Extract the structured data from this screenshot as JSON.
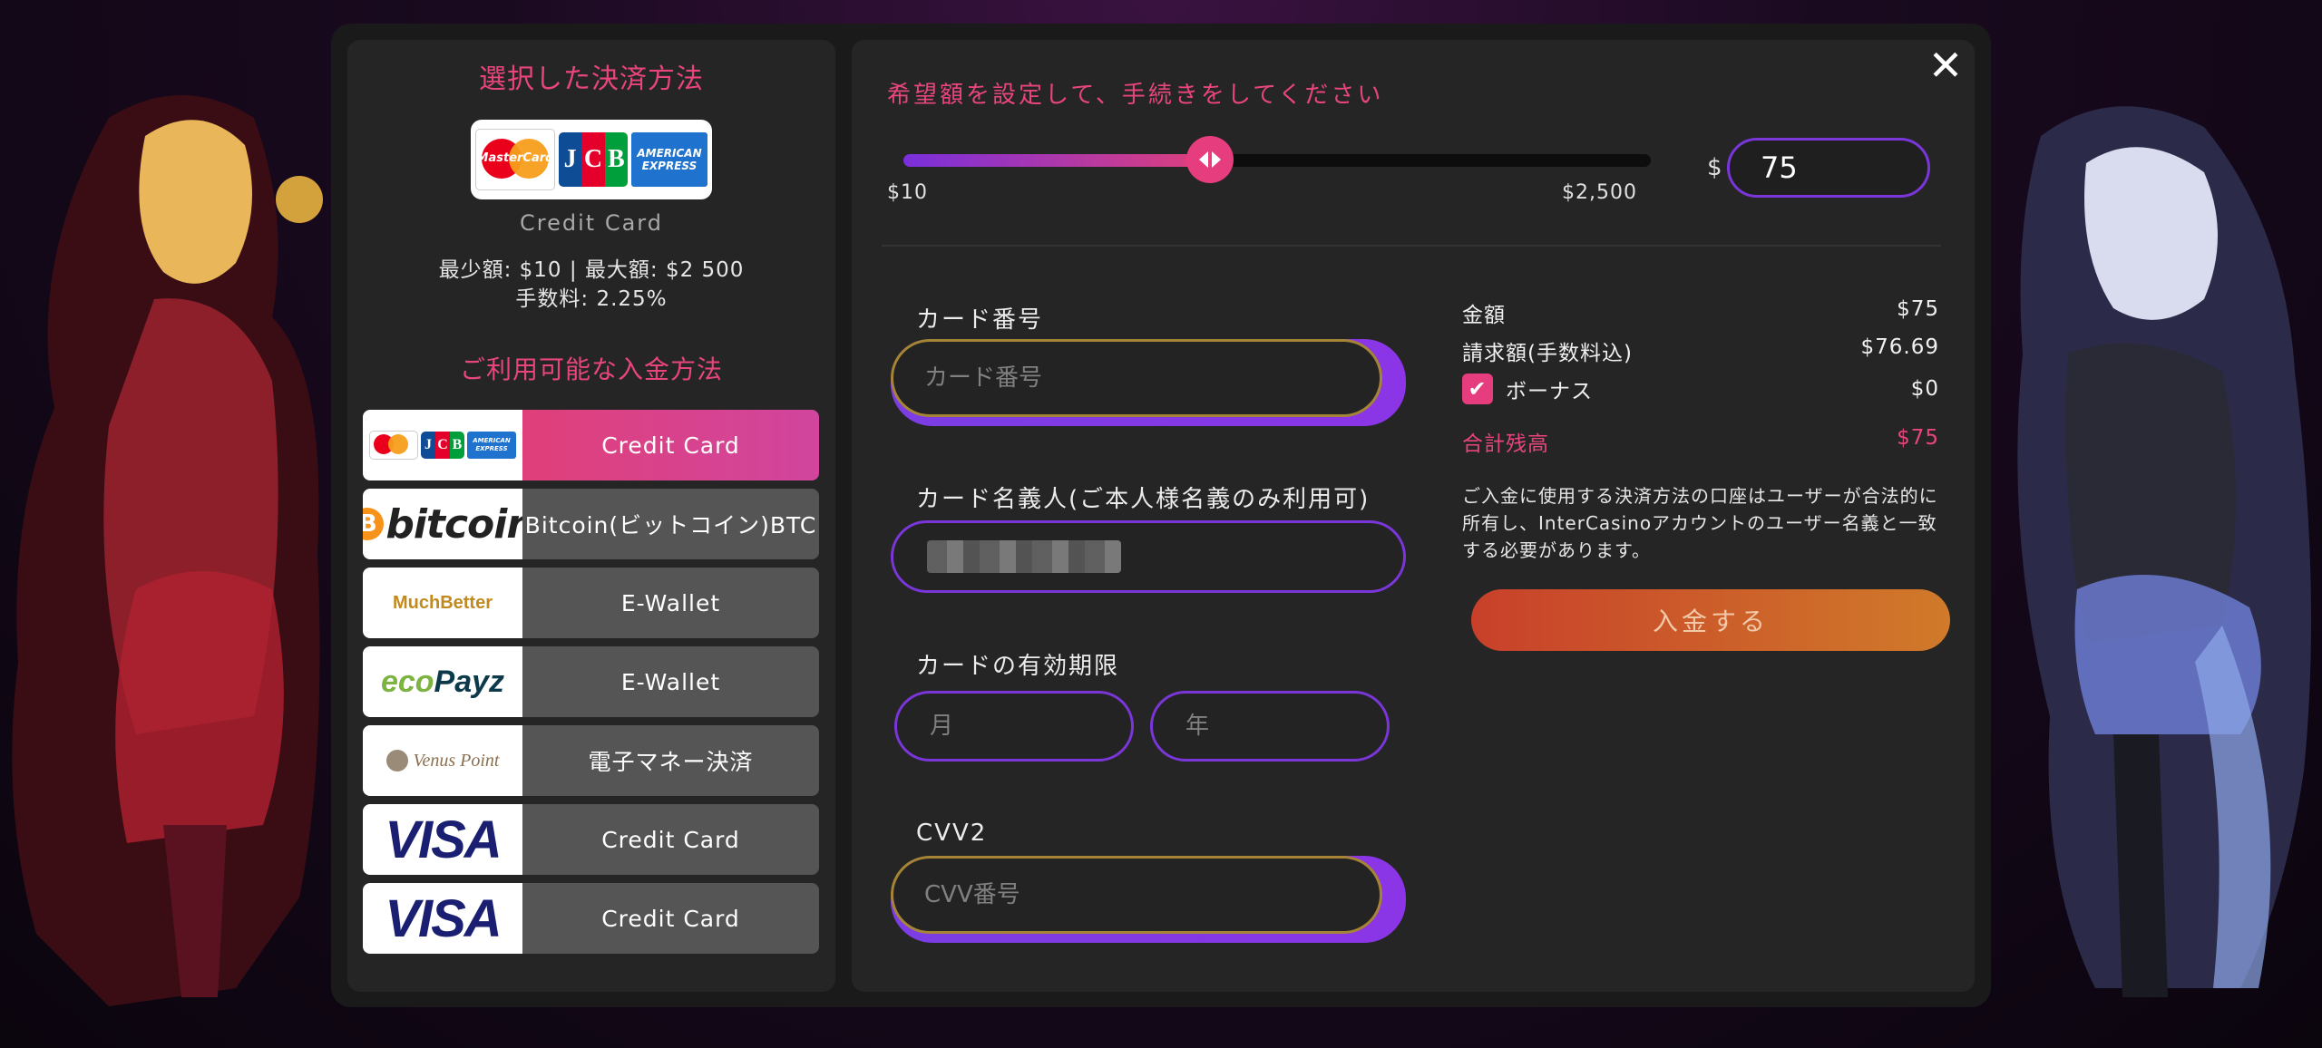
{
  "close_icon": "close-icon",
  "selected": {
    "title": "選択した決済方法",
    "logo_text": {
      "mastercard": "MasterCard",
      "jcb": [
        "J",
        "C",
        "B"
      ],
      "amex_line1": "AMERICAN",
      "amex_line2": "EXPRESS"
    },
    "label": "Credit Card",
    "limits_line": "最少額: $10 | 最大額: $2 500",
    "fee_line": "手数料: 2.25%"
  },
  "available_title": "ご利用可能な入金方法",
  "methods": [
    {
      "logo": "credit-card-brands",
      "label": "Credit Card",
      "active": true
    },
    {
      "logo": "bitcoin",
      "logo_text": "bitcoin",
      "logo_symbol": "B",
      "label": "Bitcoin(ビットコイン)BTC"
    },
    {
      "logo": "muchbetter",
      "logo_text": "MuchBetter",
      "label": "E-Wallet"
    },
    {
      "logo": "ecopayz",
      "logo_text_a": "eco",
      "logo_text_b": "Payz",
      "label": "E-Wallet"
    },
    {
      "logo": "venuspoint",
      "logo_text": "Venus Point",
      "label": "電子マネー決済"
    },
    {
      "logo": "visa",
      "logo_text": "VISA",
      "label": "Credit Card"
    },
    {
      "logo": "visa",
      "logo_text": "VISA",
      "label": "Credit Card"
    }
  ],
  "amount": {
    "title": "希望額を設定して、手続きをしてください",
    "min_label": "$10",
    "max_label": "$2,500",
    "min": 10,
    "max": 2500,
    "value": 75,
    "slider_fraction": 0.41,
    "currency": "$",
    "input_value": "75"
  },
  "form": {
    "card_number_label": "カード番号",
    "card_number_placeholder": "カード番号",
    "holder_label": "カード名義人(ご本人様名義のみ利用可)",
    "expiry_label": "カードの有効期限",
    "month_placeholder": "月",
    "year_placeholder": "年",
    "cvv_label": "CVV2",
    "cvv_placeholder": "CVV番号"
  },
  "summary": {
    "amount_label": "金額",
    "amount_value": "$75",
    "billed_label": "請求額(手数料込)",
    "billed_value": "$76.69",
    "bonus_label": "ボーナス",
    "bonus_value": "$0",
    "bonus_checked": true,
    "total_label": "合計残高",
    "total_value": "$75",
    "notice": "ご入金に使用する決済方法の口座はユーザーが合法的に所有し、InterCasinoアカウントのユーザー名義と一致する必要があります。",
    "deposit_button": "入金する"
  },
  "colors": {
    "accent_pink": "#e8457e",
    "accent_violet": "#7a36d9",
    "deposit_orange": "#c8402a"
  }
}
